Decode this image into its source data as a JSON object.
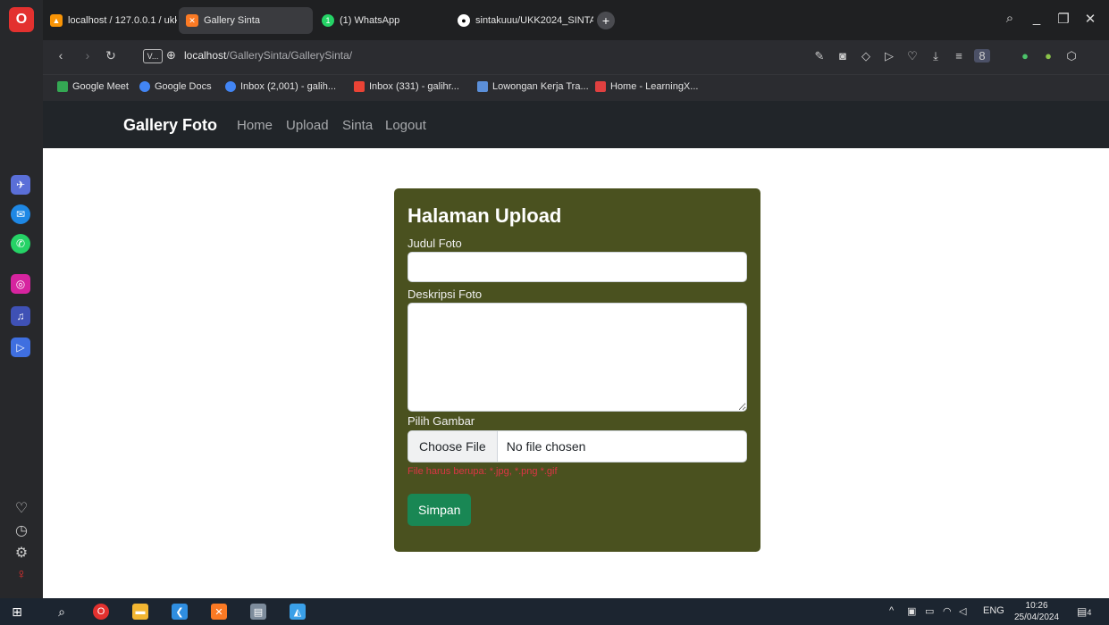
{
  "browser": {
    "tabs": [
      {
        "label": "localhost / 127.0.0.1 / ukk",
        "icon": "phpmyadmin-icon",
        "active": false
      },
      {
        "label": "Gallery Sinta",
        "icon": "xampp-icon",
        "active": true
      },
      {
        "label": "(1) WhatsApp",
        "icon": "whatsapp-icon",
        "active": false
      },
      {
        "label": "sintakuuu/UKK2024_SINTA",
        "icon": "github-icon",
        "active": false
      }
    ],
    "new_tab": "+",
    "address": {
      "badge": "V...",
      "host": "localhost",
      "path": "/GallerySinta/GallerySinta/"
    },
    "bookmarks": [
      {
        "label": "Google Meet",
        "color": "#34a853"
      },
      {
        "label": "Google Docs",
        "color": "#4285f4"
      },
      {
        "label": "Inbox (2,001) - galih...",
        "color": "#4285f4"
      },
      {
        "label": "Inbox (331) - galihr...",
        "color": "#ea4335"
      },
      {
        "label": "Lowongan Kerja Tra...",
        "color": "#5b8fd9"
      },
      {
        "label": "Home - LearningX...",
        "color": "#e04040"
      }
    ]
  },
  "navbar": {
    "brand": "Gallery Foto",
    "links": [
      "Home",
      "Upload",
      "Sinta",
      "Logout"
    ]
  },
  "upload_form": {
    "title": "Halaman Upload",
    "title_label": "Judul Foto",
    "title_value": "",
    "description_label": "Deskripsi Foto",
    "description_value": "",
    "image_label": "Pilih Gambar",
    "file_button": "Choose File",
    "file_status": "No file chosen",
    "hint": "File harus berupa: *.jpg, *.png *.gif",
    "submit": "Simpan"
  },
  "taskbar": {
    "language": "ENG",
    "time": "10:26",
    "date": "25/04/2024",
    "notifications": "4"
  },
  "colors": {
    "card_bg": "#4a511f",
    "navbar_bg": "#212529",
    "submit_bg": "#198754",
    "hint": "#dc3545"
  }
}
